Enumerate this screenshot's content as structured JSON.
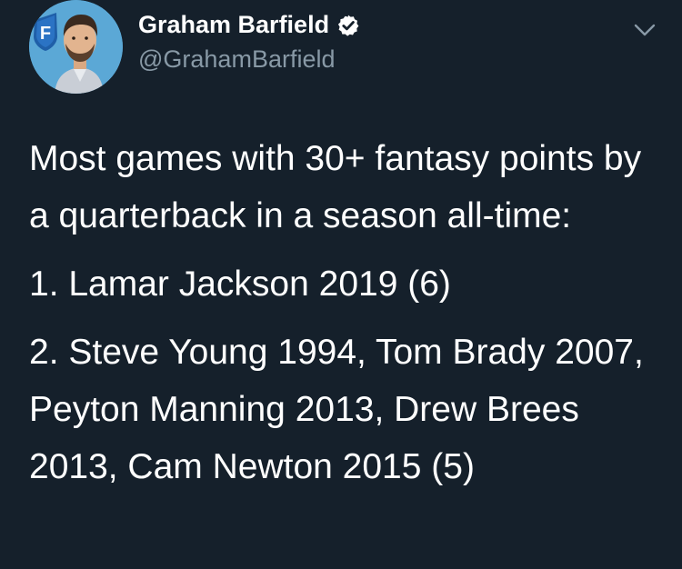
{
  "author": {
    "display_name": "Graham Barfield",
    "handle": "@GrahamBarfield",
    "verified": true,
    "avatar_badge_letter": "F",
    "avatar_bg_color": "#5ba8d6",
    "badge_color": "#1f5fa8"
  },
  "tweet": {
    "intro": "Most games with 30+ fantasy points by a quarterback in a season all-time:",
    "item_1": "1. Lamar Jackson 2019 (6)",
    "item_2": "2. Steve Young 1994, Tom Brady 2007, Peyton Manning 2013, Drew Brees 2013, Cam Newton 2015 (5)"
  },
  "icons": {
    "verified": "verified-badge-icon",
    "menu": "chevron-down-icon"
  },
  "colors": {
    "background": "#15202b",
    "text_primary": "#ffffff",
    "text_secondary": "#8899a6"
  }
}
